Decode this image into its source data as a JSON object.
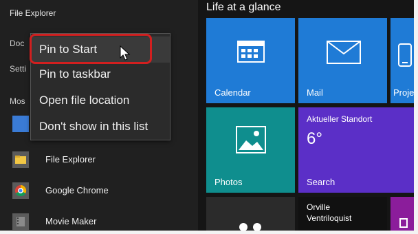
{
  "start_menu": {
    "title": "File Explorer",
    "left_partial": [
      "Doc",
      "Setti",
      "Mos"
    ],
    "apps": [
      {
        "label": "File Explorer",
        "icon": "folder-icon",
        "color": "#f2c744"
      },
      {
        "label": "Google Chrome",
        "icon": "chrome-icon",
        "color": "#db4437"
      },
      {
        "label": "Movie Maker",
        "icon": "film-icon",
        "color": "#6b6b6b"
      }
    ]
  },
  "context_menu": {
    "items": [
      "Pin to Start",
      "Pin to taskbar",
      "Open file location",
      "Don't show in this list"
    ],
    "highlighted_index": 0
  },
  "tiles_section": {
    "title": "Life at a glance",
    "tiles": [
      {
        "label": "Calendar",
        "icon": "calendar-icon",
        "color": "#1f7bd6"
      },
      {
        "label": "Mail",
        "icon": "mail-icon",
        "color": "#1f7bd6"
      },
      {
        "label": "Proje",
        "icon": "phone-icon",
        "color": "#1f7bd6"
      },
      {
        "label": "Photos",
        "icon": "photo-icon",
        "color": "#0f8e8e"
      },
      {
        "label": "Search",
        "heading": "Aktueller Standort",
        "temp": "6°",
        "icon": "weather-icon",
        "color": "#5b2fc7"
      },
      {
        "label": "",
        "icon": "",
        "color": "#2b2b2b"
      },
      {
        "label": "",
        "heading": "Orville",
        "subheading": "Ventriloquist",
        "icon": "",
        "color": "#111111"
      },
      {
        "label": "",
        "icon": "",
        "color": "#8b1d9b"
      }
    ]
  },
  "colors": {
    "highlight_border": "#d21f1f",
    "menu_bg": "#2b2b2b",
    "left_bg": "#202020",
    "right_bg": "#151515"
  }
}
